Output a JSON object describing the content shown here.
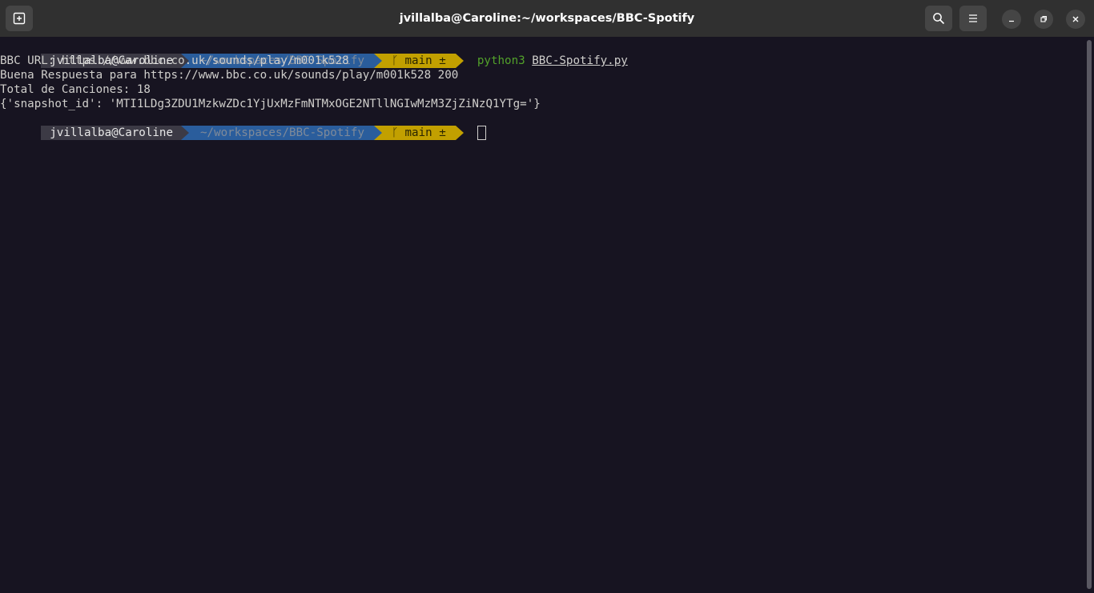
{
  "window": {
    "title": "jvillalba@Caroline:~/workspaces/BBC-Spotify"
  },
  "header": {
    "icons": [
      "new-tab-icon",
      "search-icon",
      "hamburger-menu-icon",
      "minimize-icon",
      "maximize-icon",
      "close-icon"
    ]
  },
  "prompt": {
    "user": "jvillalba@Caroline",
    "path": "~/workspaces/BBC-Spotify",
    "branch": "main ±"
  },
  "terminal": {
    "command": "python3",
    "argument": "BBC-Spotify.py",
    "output": [
      "BBC URL: https://www.bbc.co.uk/sounds/play/m001k528",
      "Buena Respuesta para https://www.bbc.co.uk/sounds/play/m001k528 200",
      "Total de Canciones: 18",
      "{'snapshot_id': 'MTI1LDg3ZDU1MzkwZDc1YjUxMzFmNTMxOGE2NTllNGIwMzM3ZjZiNzQ1YTg='}"
    ]
  },
  "colors": {
    "background": "#171421",
    "headerbar": "#303030",
    "prompt_user_bg": "#3c3a45",
    "prompt_path_bg": "#2a5d9c",
    "prompt_git_bg": "#c2a000",
    "command_green": "#52a12a"
  }
}
